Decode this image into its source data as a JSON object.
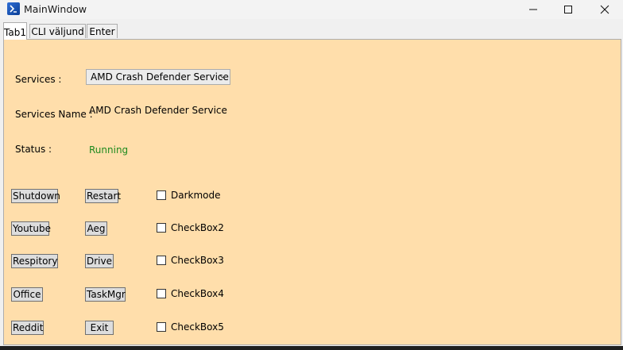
{
  "window": {
    "title": "MainWindow",
    "icon": "powershell-icon"
  },
  "tabs": [
    {
      "label": "Tab1",
      "active": true
    },
    {
      "label": "CLI väljund",
      "active": false
    },
    {
      "label": "Enter",
      "active": false
    }
  ],
  "form": {
    "services_label": "Services :",
    "services_selected": "AMD Crash Defender Service",
    "service_name_label": "Services Name :",
    "service_name_value": "AMD Crash Defender Service",
    "status_label": "Status :",
    "status_value": "Running",
    "status_color": "#1e8a1e",
    "panel_background": "#ffdeab"
  },
  "buttons": {
    "shutdown": "Shutdown",
    "restart": "Restart",
    "youtube": "Youtube",
    "aeg": "Aeg",
    "respitory": "Respitory",
    "drive": "Drive",
    "office": "Office",
    "taskmgr": "TaskMgr",
    "reddit": "Reddit",
    "exit": "Exit"
  },
  "checkboxes": [
    {
      "label": "Darkmode",
      "checked": false
    },
    {
      "label": "CheckBox2",
      "checked": false
    },
    {
      "label": "CheckBox3",
      "checked": false
    },
    {
      "label": "CheckBox4",
      "checked": false
    },
    {
      "label": "CheckBox5",
      "checked": false
    }
  ]
}
